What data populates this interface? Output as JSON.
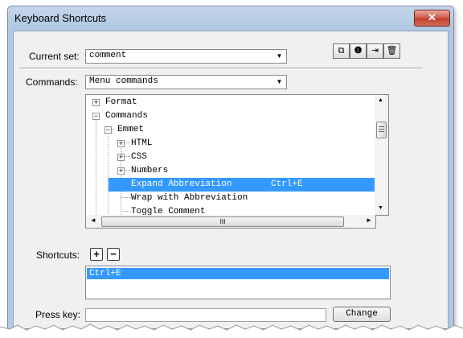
{
  "window": {
    "title": "Keyboard Shortcuts",
    "close_glyph": "✕"
  },
  "current_set": {
    "label": "Current set:",
    "value": "comment"
  },
  "toolbar": [
    "duplicate-set-icon",
    "rename-set-icon",
    "export-set-icon",
    "delete-set-icon"
  ],
  "commands": {
    "label": "Commands:",
    "value": "Menu commands"
  },
  "tree": [
    {
      "label": "Format",
      "expander": "+",
      "shortcut": ""
    },
    {
      "label": "Commands",
      "expander": "−",
      "shortcut": ""
    },
    {
      "label": "Emmet",
      "expander": "−",
      "shortcut": ""
    },
    {
      "label": "HTML",
      "expander": "+",
      "shortcut": ""
    },
    {
      "label": "CSS",
      "expander": "+",
      "shortcut": ""
    },
    {
      "label": "Numbers",
      "expander": "+",
      "shortcut": ""
    },
    {
      "label": "Expand Abbreviation",
      "expander": "",
      "shortcut": "Ctrl+E",
      "selected": true
    },
    {
      "label": "Wrap with Abbreviation",
      "expander": "",
      "shortcut": ""
    },
    {
      "label": "Toggle Comment",
      "expander": "",
      "shortcut": ""
    }
  ],
  "scrollbar": {
    "up": "▲",
    "down": "▼",
    "left": "◄",
    "right": "►",
    "grip": "III"
  },
  "shortcuts": {
    "label": "Shortcuts:",
    "add": "+",
    "remove": "−",
    "items": [
      "Ctrl+E"
    ]
  },
  "press_key": {
    "label": "Press key:",
    "value": ""
  },
  "change_button": "Change",
  "colors": {
    "selection": "#3399ff",
    "titlebar": "#b3c9e3",
    "close": "#c2412d"
  }
}
